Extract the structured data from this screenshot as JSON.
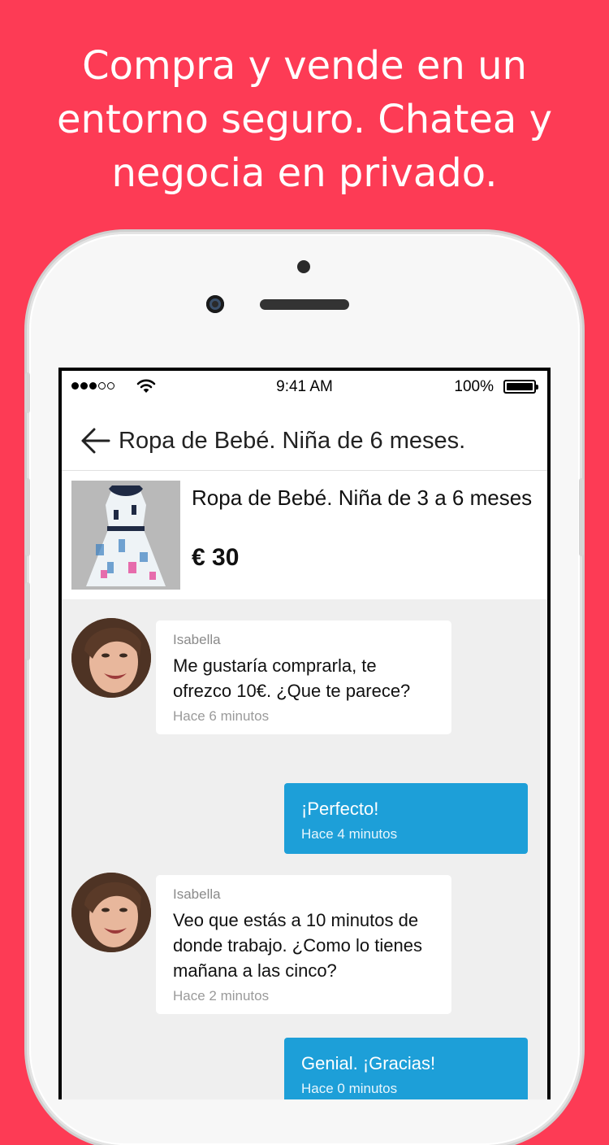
{
  "headline": {
    "line1": "Compra y vende en un",
    "line2": "entorno seguro. Chatea y",
    "line3": "negocia en privado."
  },
  "colors": {
    "background": "#fd3b55",
    "outgoing_bubble": "#1d9fd8",
    "chat_background": "#efefef"
  },
  "status_bar": {
    "time": "9:41 AM",
    "battery": "100%"
  },
  "nav": {
    "back_icon": "arrow-left-icon",
    "title": "Ropa de Bebé. Niña de 6 meses."
  },
  "product": {
    "title": "Ropa de Bebé. Niña de 3 a 6 meses",
    "price": "€ 30"
  },
  "messages": [
    {
      "direction": "incoming",
      "sender": "Isabella",
      "text": "Me gustaría comprarla, te ofrezco 10€. ¿Que te parece?",
      "time": "Hace 6 minutos"
    },
    {
      "direction": "outgoing",
      "text": "¡Perfecto!",
      "time": "Hace 4 minutos"
    },
    {
      "direction": "incoming",
      "sender": "Isabella",
      "text": "Veo que estás a 10 minutos de donde trabajo. ¿Como lo tienes mañana a las cinco?",
      "time": "Hace 2 minutos"
    },
    {
      "direction": "outgoing",
      "text": "Genial. ¡Gracias!",
      "time": "Hace 0 minutos"
    }
  ]
}
